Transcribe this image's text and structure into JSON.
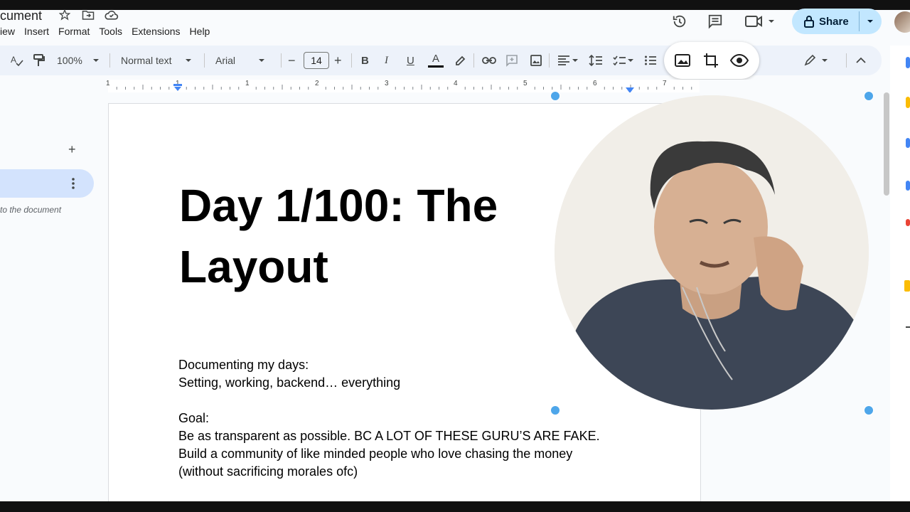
{
  "header": {
    "doc_title": "cument",
    "menu": [
      "iew",
      "Insert",
      "Format",
      "Tools",
      "Extensions",
      "Help"
    ],
    "share_label": "Share"
  },
  "toolbar": {
    "zoom": "100%",
    "style": "Normal text",
    "font": "Arial",
    "font_size": "14",
    "minus": "−",
    "plus": "+",
    "bold": "B",
    "italic": "I",
    "underline": "U",
    "text_color": "A"
  },
  "ruler": {
    "numbers": [
      "1",
      "1",
      "1",
      "2",
      "3",
      "4",
      "5",
      "6",
      "7"
    ]
  },
  "sidebar": {
    "add_symbol": "+",
    "outline_hint": "to the document"
  },
  "document": {
    "title_line1": "Day 1/100: The",
    "title_line2": "Layout",
    "lines": [
      "Documenting my days:",
      "Setting, working, backend… everything",
      "",
      "Goal:",
      "Be as transparent as possible. BC A LOT OF THESE GURU’S ARE FAKE.",
      "Build a community of like minded people who love chasing the money",
      "(without sacrificing morales ofc)"
    ]
  },
  "colors": {
    "accent": "#c2e7ff",
    "selection": "#4ea6ea",
    "tab_active": "#d3e3fd"
  }
}
